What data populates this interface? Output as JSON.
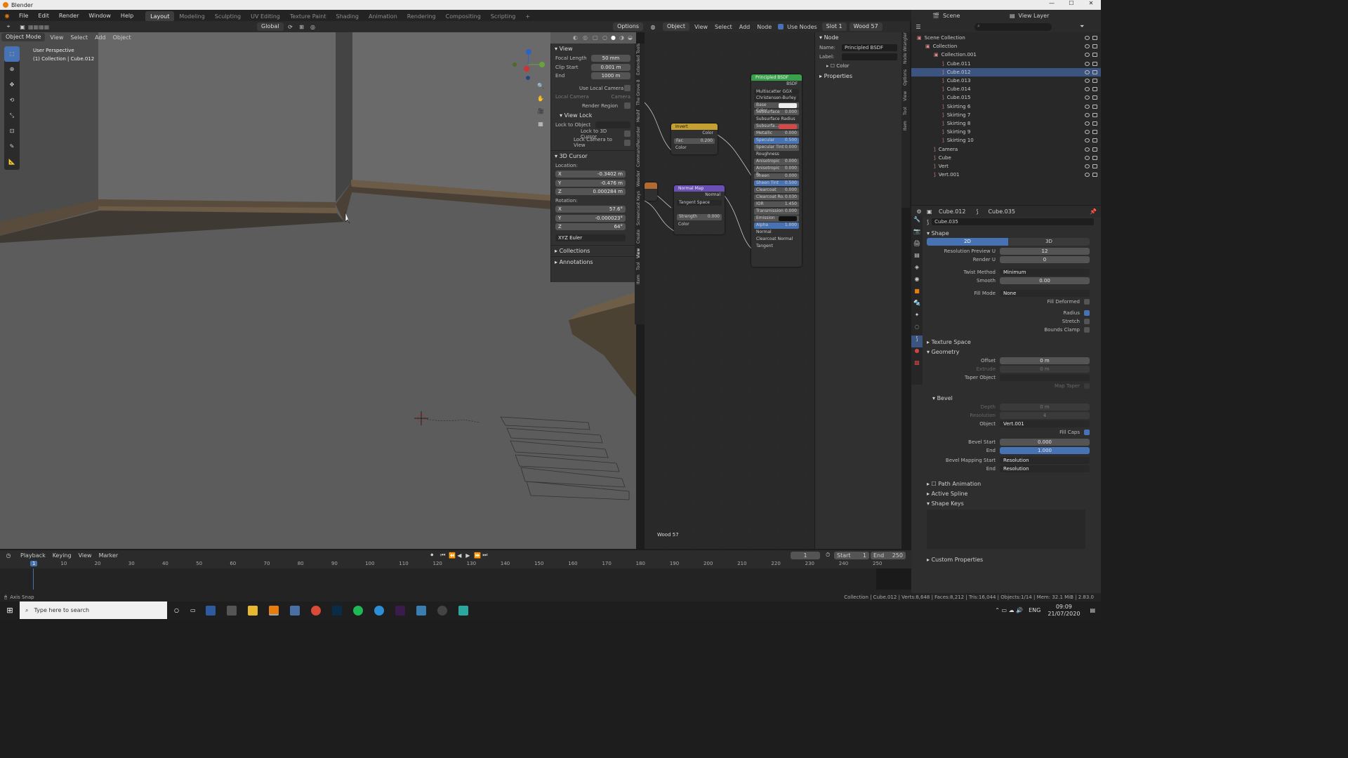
{
  "app": {
    "title": "Blender"
  },
  "menu": {
    "items": [
      "File",
      "Edit",
      "Render",
      "Window",
      "Help"
    ]
  },
  "workspaces": [
    "Layout",
    "Modeling",
    "Sculpting",
    "UV Editing",
    "Texture Paint",
    "Shading",
    "Animation",
    "Rendering",
    "Compositing",
    "Scripting",
    "+"
  ],
  "vp_header": {
    "mode": "Object Mode",
    "menus": [
      "View",
      "Select",
      "Add",
      "Object"
    ],
    "orientation": "Global",
    "options": "Options"
  },
  "vp_overlay": {
    "perspective": "User Perspective",
    "collection": "(1) Collection | Cube.012"
  },
  "npanel": {
    "tabs": [
      "Item",
      "Tool",
      "View",
      "Create",
      "Screencast Keys",
      "Weeder",
      "CommandRecorder",
      "Meshf",
      "The Grove 8",
      "Extended Tools"
    ],
    "view_section": "View",
    "focal_label": "Focal Length",
    "focal": "50 mm",
    "clip_start_label": "Clip Start",
    "clip_start": "0.001 m",
    "end_label": "End",
    "clip_end": "1000 m",
    "use_local_camera": "Use Local Camera",
    "local_camera_label": "Local Camera",
    "local_camera": "Camera",
    "render_region": "Render Region",
    "view_lock": "View Lock",
    "lock_to_object": "Lock to Object",
    "lock_3d_cursor": "Lock to 3D Cursor",
    "lock_camera": "Lock Camera to View",
    "cursor_section": "3D Cursor",
    "location_label": "Location:",
    "loc": [
      {
        "axis": "X",
        "value": "-0.3402 m"
      },
      {
        "axis": "Y",
        "value": "-0.476 m"
      },
      {
        "axis": "Z",
        "value": "0.000284 m"
      }
    ],
    "rotation_label": "Rotation:",
    "rot": [
      {
        "axis": "X",
        "value": "57.6°"
      },
      {
        "axis": "Y",
        "value": "-0.000023°"
      },
      {
        "axis": "Z",
        "value": "64°"
      }
    ],
    "euler": "XYZ Euler",
    "collections": "Collections",
    "annotations": "Annotations"
  },
  "ne_header": {
    "type": "Object",
    "menus": [
      "View",
      "Select",
      "Add",
      "Node"
    ],
    "use_nodes": "Use Nodes",
    "slot": "Slot 1",
    "material": "Wood 57"
  },
  "nodes": {
    "invert": {
      "title": "Invert",
      "out": "Color",
      "fac_label": "Fac",
      "fac": "0.200",
      "color_in": "Color"
    },
    "normal_map": {
      "title": "Normal Map",
      "out": "Normal",
      "space": "Tangent Space",
      "strength_label": "Strength",
      "strength": "0.000",
      "color_in": "Color"
    },
    "bsdf": {
      "title": "Principled BSDF",
      "out": "BSDF",
      "dist": "Multiscatter GGX",
      "sss": "Christensen-Burley",
      "rows": [
        {
          "name": "Base Color",
          "value": ""
        },
        {
          "name": "Subsurface",
          "value": "0.000"
        },
        {
          "name": "Subsurface Radius",
          "value": ""
        },
        {
          "name": "Subsurfa...",
          "value": ""
        },
        {
          "name": "Metallic",
          "value": "0.000"
        },
        {
          "name": "Specular",
          "value": "0.500"
        },
        {
          "name": "Specular Tint",
          "value": "0.000"
        },
        {
          "name": "Roughness",
          "value": ""
        },
        {
          "name": "Anisotropic",
          "value": "0.000"
        },
        {
          "name": "Anisotropic R.",
          "value": "0.000"
        },
        {
          "name": "Sheen",
          "value": "0.000"
        },
        {
          "name": "Sheen Tint",
          "value": "0.500"
        },
        {
          "name": "Clearcoat",
          "value": "0.000"
        },
        {
          "name": "Clearcoat Ro.",
          "value": "0.030"
        },
        {
          "name": "IOR",
          "value": "1.450"
        },
        {
          "name": "Transmission",
          "value": "0.000"
        },
        {
          "name": "Emission",
          "value": ""
        },
        {
          "name": "Alpha",
          "value": "1.000"
        },
        {
          "name": "Normal",
          "value": ""
        },
        {
          "name": "Clearcoat Normal",
          "value": ""
        },
        {
          "name": "Tangent",
          "value": ""
        }
      ]
    },
    "material_label": "Wood 57"
  },
  "node_side": {
    "section": "Node",
    "name_label": "Name:",
    "name": "Principled BSDF",
    "label_label": "Label:",
    "color": "Color",
    "properties": "Properties",
    "tabs": [
      "Item",
      "Tool",
      "View",
      "Options",
      "Node Wrangler"
    ]
  },
  "outliner": {
    "scene": "Scene",
    "view_layer": "View Layer",
    "rows": [
      {
        "name": "Scene Collection",
        "indent": 0,
        "sel": false
      },
      {
        "name": "Collection",
        "indent": 1,
        "sel": false
      },
      {
        "name": "Collection.001",
        "indent": 2,
        "sel": false
      },
      {
        "name": "Cube.011",
        "indent": 3,
        "sel": false
      },
      {
        "name": "Cube.012",
        "indent": 3,
        "sel": true
      },
      {
        "name": "Cube.013",
        "indent": 3,
        "sel": false
      },
      {
        "name": "Cube.014",
        "indent": 3,
        "sel": false
      },
      {
        "name": "Cube.015",
        "indent": 3,
        "sel": false
      },
      {
        "name": "Skirting 6",
        "indent": 3,
        "sel": false
      },
      {
        "name": "Skirting 7",
        "indent": 3,
        "sel": false
      },
      {
        "name": "Skirting 8",
        "indent": 3,
        "sel": false
      },
      {
        "name": "Skirting 9",
        "indent": 3,
        "sel": false
      },
      {
        "name": "Skirting 10",
        "indent": 3,
        "sel": false
      },
      {
        "name": "Camera",
        "indent": 2,
        "sel": false
      },
      {
        "name": "Cube",
        "indent": 2,
        "sel": false
      },
      {
        "name": "Vert",
        "indent": 2,
        "sel": false
      },
      {
        "name": "Vert.001",
        "indent": 2,
        "sel": false
      }
    ]
  },
  "props": {
    "obj": "Cube.012",
    "data": "Cube.035",
    "data_name": "Cube.035",
    "shape": "Shape",
    "dim2d": "2D",
    "dim3d": "3D",
    "res_preview_label": "Resolution Preview U",
    "res_preview": "12",
    "render_u_label": "Render U",
    "render_u": "0",
    "twist_label": "Twist Method",
    "twist": "Minimum",
    "smooth_label": "Smooth",
    "smooth": "0.00",
    "fill_mode_label": "Fill Mode",
    "fill_mode": "None",
    "fill_deformed": "Fill Deformed",
    "radius": "Radius",
    "stretch": "Stretch",
    "bounds_clamp": "Bounds Clamp",
    "texture_space": "Texture Space",
    "geometry": "Geometry",
    "offset_label": "Offset",
    "offset": "0 m",
    "extrude_label": "Extrude",
    "extrude": "0 m",
    "taper_label": "Taper Object",
    "map_taper": "Map Taper",
    "bevel": "Bevel",
    "depth_label": "Depth",
    "depth": "0 m",
    "resolution_label": "Resolution",
    "resolution": "4",
    "object_label": "Object",
    "object": "Vert.001",
    "fill_caps": "Fill Caps",
    "bevel_start_label": "Bevel Start",
    "bevel_start": "0.000",
    "end_label": "End",
    "bevel_end": "1.000",
    "mapping_start_label": "Bevel Mapping Start",
    "mapping_start": "Resolution",
    "mapping_end_label": "End",
    "mapping_end": "Resolution",
    "path_anim": "Path Animation",
    "active_spline": "Active Spline",
    "shape_keys": "Shape Keys",
    "custom_props": "Custom Properties"
  },
  "timeline": {
    "menus": [
      "Playback",
      "Keying",
      "View",
      "Marker"
    ],
    "current": "1",
    "start_label": "Start",
    "start": "1",
    "end_label": "End",
    "end": "250",
    "ticks": [
      "1",
      "10",
      "20",
      "30",
      "40",
      "50",
      "60",
      "70",
      "80",
      "90",
      "100",
      "110",
      "120",
      "130",
      "140",
      "150",
      "160",
      "170",
      "180",
      "190",
      "200",
      "210",
      "220",
      "230",
      "240",
      "250"
    ]
  },
  "status": {
    "left": "Axis Snap",
    "right": "Collection | Cube.012 | Verts:8,648 | Faces:8,212 | Tris:16,044 | Objects:1/14 | Mem: 32.1 MiB | 2.83.0"
  },
  "taskbar": {
    "search": "Type here to search",
    "lang": "ENG",
    "time": "09:09",
    "date": "21/07/2020"
  }
}
